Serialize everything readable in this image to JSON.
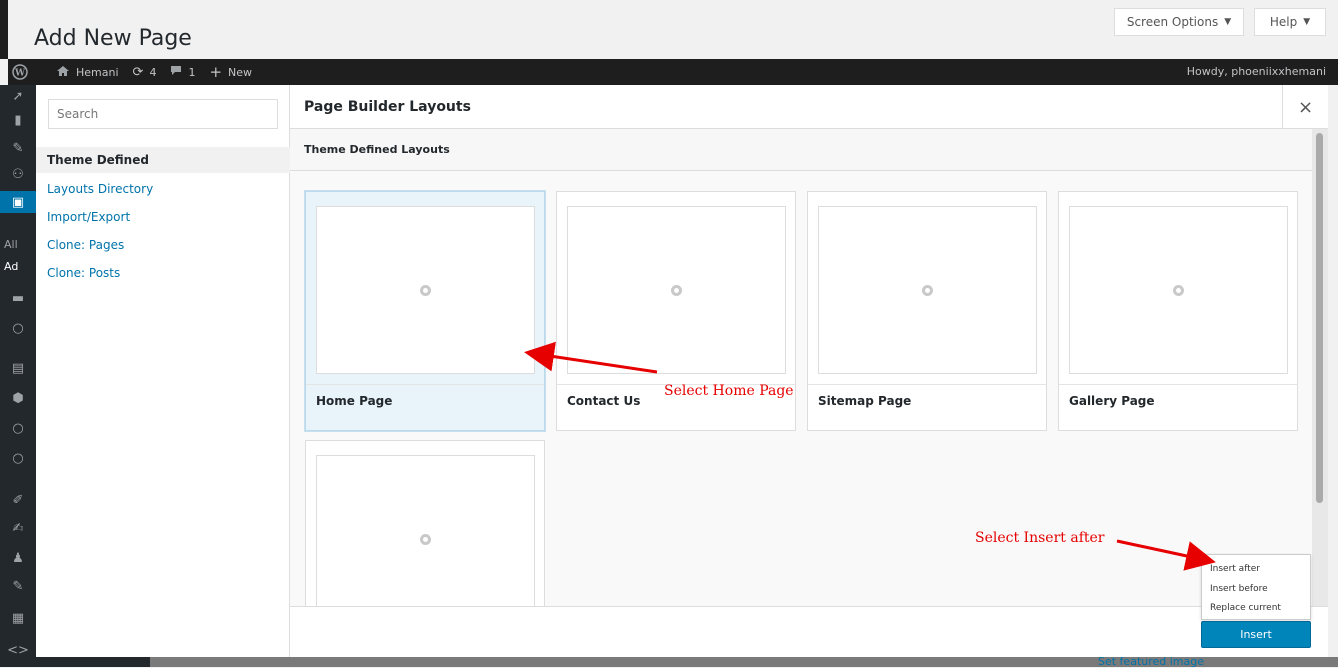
{
  "wp": {
    "page_title": "Add New Page",
    "screen_options_label": "Screen Options",
    "help_label": "Help",
    "admin_bar": {
      "site_name": "Hemani",
      "updates_count": "4",
      "comments_count": "1",
      "new_label": "New",
      "howdy": "Howdy, phoeniixxhemani"
    },
    "menu_text_all": "All",
    "menu_text_add": "Ad",
    "featured_link": "Set featured image"
  },
  "modal": {
    "title": "Page Builder Layouts",
    "close_icon": "×",
    "search_placeholder": "Search",
    "nav": [
      {
        "label": "Theme Defined"
      },
      {
        "label": "Layouts Directory"
      },
      {
        "label": "Import/Export"
      },
      {
        "label": "Clone: Pages"
      },
      {
        "label": "Clone: Posts"
      }
    ],
    "section_title": "Theme Defined Layouts",
    "layouts": [
      {
        "title": "Home Page"
      },
      {
        "title": "Contact Us"
      },
      {
        "title": "Sitemap Page"
      },
      {
        "title": "Gallery Page"
      },
      {
        "title": ""
      }
    ],
    "dropdown": [
      {
        "label": "Insert after"
      },
      {
        "label": "Insert before"
      },
      {
        "label": "Replace current"
      }
    ],
    "insert_label": "Insert"
  },
  "annotations": {
    "select_home": "Select Home Page",
    "select_insert": "Select Insert after",
    "color": "#e60000"
  },
  "colors": {
    "primary": "#0085ba",
    "link": "#0073aa",
    "admin_bar": "#1e1e1e"
  }
}
